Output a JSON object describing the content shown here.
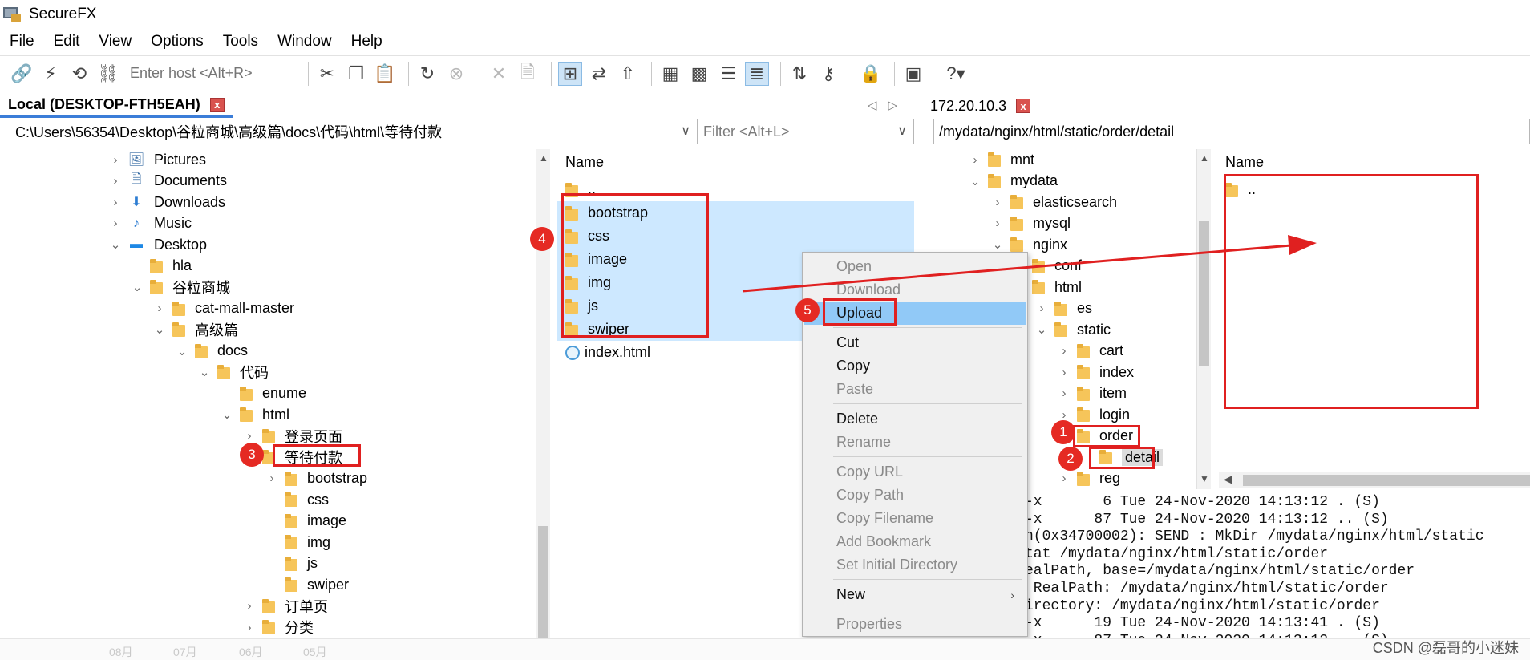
{
  "app": {
    "title": "SecureFX"
  },
  "menu": [
    "File",
    "Edit",
    "View",
    "Options",
    "Tools",
    "Window",
    "Help"
  ],
  "toolbar": {
    "host_placeholder": "Enter host <Alt+R>"
  },
  "local": {
    "tab_title": "Local (DESKTOP-FTH5EAH)",
    "path": "C:\\Users\\56354\\Desktop\\谷粒商城\\高级篇\\docs\\代码\\html\\等待付款",
    "filter_placeholder": "Filter <Alt+L>",
    "tree": [
      {
        "label": "Pictures",
        "exp": ">",
        "icon": "pictures-icon"
      },
      {
        "label": "Documents",
        "exp": ">",
        "icon": "documents-icon"
      },
      {
        "label": "Downloads",
        "exp": ">",
        "icon": "downloads-icon"
      },
      {
        "label": "Music",
        "exp": ">",
        "icon": "music-icon"
      },
      {
        "label": "Desktop",
        "exp": "v",
        "icon": "desktop-icon"
      },
      {
        "label": "hla",
        "exp": "",
        "icon": "folder-icon"
      },
      {
        "label": "谷粒商城",
        "exp": "v",
        "icon": "folder-icon"
      },
      {
        "label": "cat-mall-master",
        "exp": ">",
        "icon": "folder-icon"
      },
      {
        "label": "高级篇",
        "exp": "v",
        "icon": "folder-icon"
      },
      {
        "label": "docs",
        "exp": "v",
        "icon": "folder-icon"
      },
      {
        "label": "代码",
        "exp": "v",
        "icon": "folder-icon"
      },
      {
        "label": "enume",
        "exp": "",
        "icon": "folder-icon"
      },
      {
        "label": "html",
        "exp": "v",
        "icon": "folder-icon"
      },
      {
        "label": "登录页面",
        "exp": ">",
        "icon": "folder-icon"
      },
      {
        "label": "等待付款",
        "exp": "v",
        "icon": "folder-icon"
      },
      {
        "label": "bootstrap",
        "exp": ">",
        "icon": "folder-icon"
      },
      {
        "label": "css",
        "exp": "",
        "icon": "folder-icon"
      },
      {
        "label": "image",
        "exp": "",
        "icon": "folder-icon"
      },
      {
        "label": "img",
        "exp": "",
        "icon": "folder-icon"
      },
      {
        "label": "js",
        "exp": "",
        "icon": "folder-icon"
      },
      {
        "label": "swiper",
        "exp": "",
        "icon": "folder-icon"
      },
      {
        "label": "订单页",
        "exp": ">",
        "icon": "folder-icon"
      },
      {
        "label": "分类",
        "exp": ">",
        "icon": "folder-icon"
      }
    ],
    "list_header": "Name",
    "files": [
      {
        "label": "..",
        "type": "folder"
      },
      {
        "label": "bootstrap",
        "type": "folder"
      },
      {
        "label": "css",
        "type": "folder"
      },
      {
        "label": "image",
        "type": "folder"
      },
      {
        "label": "img",
        "type": "folder"
      },
      {
        "label": "js",
        "type": "folder"
      },
      {
        "label": "swiper",
        "type": "folder"
      },
      {
        "label": "index.html",
        "type": "html"
      }
    ]
  },
  "remote": {
    "tab_title": "172.20.10.3",
    "path": "/mydata/nginx/html/static/order/detail",
    "tree": [
      {
        "label": "mnt",
        "exp": ">"
      },
      {
        "label": "mydata",
        "exp": "v"
      },
      {
        "label": "elasticsearch",
        "exp": ">"
      },
      {
        "label": "mysql",
        "exp": ">"
      },
      {
        "label": "nginx",
        "exp": "v"
      },
      {
        "label": "conf",
        "exp": ""
      },
      {
        "label": "html",
        "exp": ""
      },
      {
        "label": "es",
        "exp": ">"
      },
      {
        "label": "static",
        "exp": "v"
      },
      {
        "label": "cart",
        "exp": ">"
      },
      {
        "label": "index",
        "exp": ">"
      },
      {
        "label": "item",
        "exp": ">"
      },
      {
        "label": "login",
        "exp": ">"
      },
      {
        "label": "order",
        "exp": "v"
      },
      {
        "label": "detail",
        "exp": ""
      },
      {
        "label": "reg",
        "exp": ">"
      }
    ],
    "list_header": "Name",
    "files": [
      {
        "label": ".."
      }
    ]
  },
  "context_menu": {
    "items": [
      {
        "label": "Open",
        "disabled": true
      },
      {
        "label": "Download",
        "disabled": true
      },
      {
        "label": "Upload",
        "highlight": true
      },
      {
        "sep": true
      },
      {
        "label": "Cut"
      },
      {
        "label": "Copy"
      },
      {
        "label": "Paste",
        "disabled": true
      },
      {
        "sep": true
      },
      {
        "label": "Delete"
      },
      {
        "label": "Rename",
        "disabled": true
      },
      {
        "sep": true
      },
      {
        "label": "Copy URL",
        "disabled": true
      },
      {
        "label": "Copy Path",
        "disabled": true
      },
      {
        "label": "Copy Filename",
        "disabled": true
      },
      {
        "label": "Add Bookmark",
        "disabled": true
      },
      {
        "label": "Set Initial Directory",
        "disabled": true
      },
      {
        "sep": true
      },
      {
        "label": "New",
        "submenu": true
      },
      {
        "sep": true
      },
      {
        "label": "Properties",
        "disabled": true
      }
    ]
  },
  "log_lines": [
    "-x       6 Tue 24-Nov-2020 14:13:12 . (S)",
    "-x      87 Tue 24-Nov-2020 14:13:12 .. (S)",
    "n(0x34700002): SEND : MkDir /mydata/nginx/html/static",
    "tat /mydata/nginx/html/static/order",
    "ealPath, base=/mydata/nginx/html/static/order",
    " RealPath: /mydata/nginx/html/static/order",
    "irectory: /mydata/nginx/html/static/order",
    "-x      19 Tue 24-Nov-2020 14:13:41 . (S)",
    "-x      87 Tue 24-Nov-2020 14:13:12 .. (S)"
  ],
  "badges": [
    "1",
    "2",
    "3",
    "4",
    "5"
  ],
  "status_fragments": [
    "08月",
    "07月",
    "06月",
    "05月"
  ],
  "watermark": "CSDN @磊哥的小迷妹"
}
